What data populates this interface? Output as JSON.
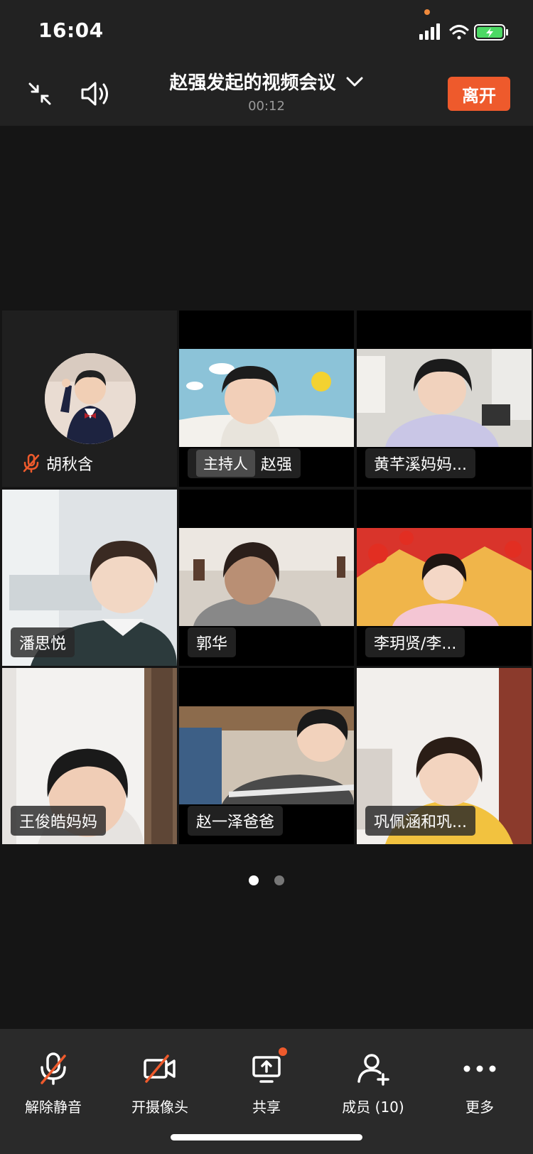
{
  "status_bar": {
    "time": "16:04"
  },
  "header": {
    "title": "赵强发起的视频会议",
    "timer": "00:12",
    "leave_label": "离开"
  },
  "participants": [
    {
      "name": "胡秋含",
      "muted": true,
      "avatar": true
    },
    {
      "host_badge": "主持人",
      "name": "赵强"
    },
    {
      "name": "黄芊溪妈妈..."
    },
    {
      "name": "潘思悦"
    },
    {
      "name": "郭华"
    },
    {
      "name": "李玥贤/李..."
    },
    {
      "name": "王俊皓妈妈"
    },
    {
      "name": "赵一泽爸爸"
    },
    {
      "name": "巩佩涵和巩..."
    }
  ],
  "pager": {
    "total_pages": 2,
    "current_page": 1
  },
  "toolbar": {
    "unmute_label": "解除静音",
    "camera_label": "开摄像头",
    "share_label": "共享",
    "members_label": "成员 (10)",
    "more_label": "更多"
  },
  "colors": {
    "accent": "#ee5a2c",
    "background": "#151515",
    "bar": "#2a2a2a"
  }
}
